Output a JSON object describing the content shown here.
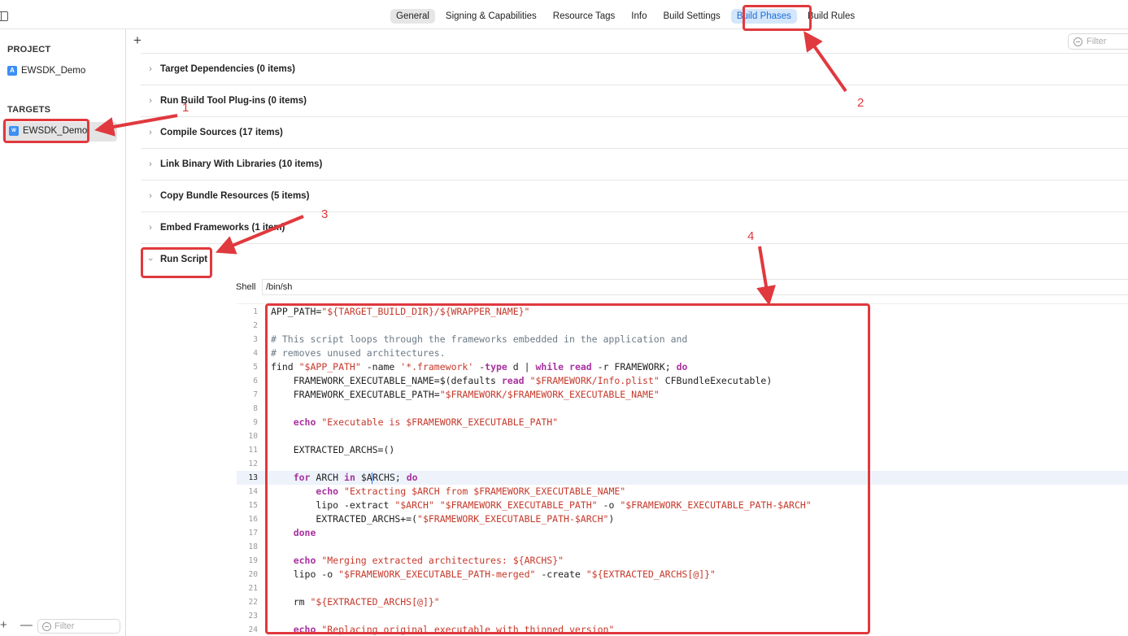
{
  "tabs": [
    "General",
    "Signing & Capabilities",
    "Resource Tags",
    "Info",
    "Build Settings",
    "Build Phases",
    "Build Rules"
  ],
  "active_tab": "Build Phases",
  "sidebar": {
    "project_header": "PROJECT",
    "project_item": "EWSDK_Demo",
    "targets_header": "TARGETS",
    "target_item": "EWSDK_Demo",
    "filter_placeholder": "Filter"
  },
  "main": {
    "filter_placeholder": "Filter",
    "phases": [
      "Target Dependencies (0 items)",
      "Run Build Tool Plug-ins (0 items)",
      "Compile Sources (17 items)",
      "Link Binary With Libraries (10 items)",
      "Copy Bundle Resources (5 items)",
      "Embed Frameworks (1 item)",
      "Run Script"
    ],
    "shell_label": "Shell",
    "shell_value": "/bin/sh"
  },
  "script_lines": [
    "APP_PATH=\"${TARGET_BUILD_DIR}/${WRAPPER_NAME}\"",
    "",
    "# This script loops through the frameworks embedded in the application and",
    "# removes unused architectures.",
    "find \"$APP_PATH\" -name '*.framework' -type d | while read -r FRAMEWORK; do",
    "    FRAMEWORK_EXECUTABLE_NAME=$(defaults read \"$FRAMEWORK/Info.plist\" CFBundleExecutable)",
    "    FRAMEWORK_EXECUTABLE_PATH=\"$FRAMEWORK/$FRAMEWORK_EXECUTABLE_NAME\"",
    "",
    "    echo \"Executable is $FRAMEWORK_EXECUTABLE_PATH\"",
    "",
    "    EXTRACTED_ARCHS=()",
    "",
    "    for ARCH in $ARCHS; do",
    "        echo \"Extracting $ARCH from $FRAMEWORK_EXECUTABLE_NAME\"",
    "        lipo -extract \"$ARCH\" \"$FRAMEWORK_EXECUTABLE_PATH\" -o \"$FRAMEWORK_EXECUTABLE_PATH-$ARCH\"",
    "        EXTRACTED_ARCHS+=(\"$FRAMEWORK_EXECUTABLE_PATH-$ARCH\")",
    "    done",
    "",
    "    echo \"Merging extracted architectures: ${ARCHS}\"",
    "    lipo -o \"$FRAMEWORK_EXECUTABLE_PATH-merged\" -create \"${EXTRACTED_ARCHS[@]}\"",
    "",
    "    rm \"${EXTRACTED_ARCHS[@]}\"",
    "",
    "    echo \"Replacing original executable with thinned version\""
  ],
  "current_line": 13,
  "annotations": [
    "1",
    "2",
    "3",
    "4"
  ],
  "colors": {
    "annotation": "#e0393e",
    "active_tab_bg": "#d3e6fb",
    "active_tab_text": "#1a6fd6"
  }
}
